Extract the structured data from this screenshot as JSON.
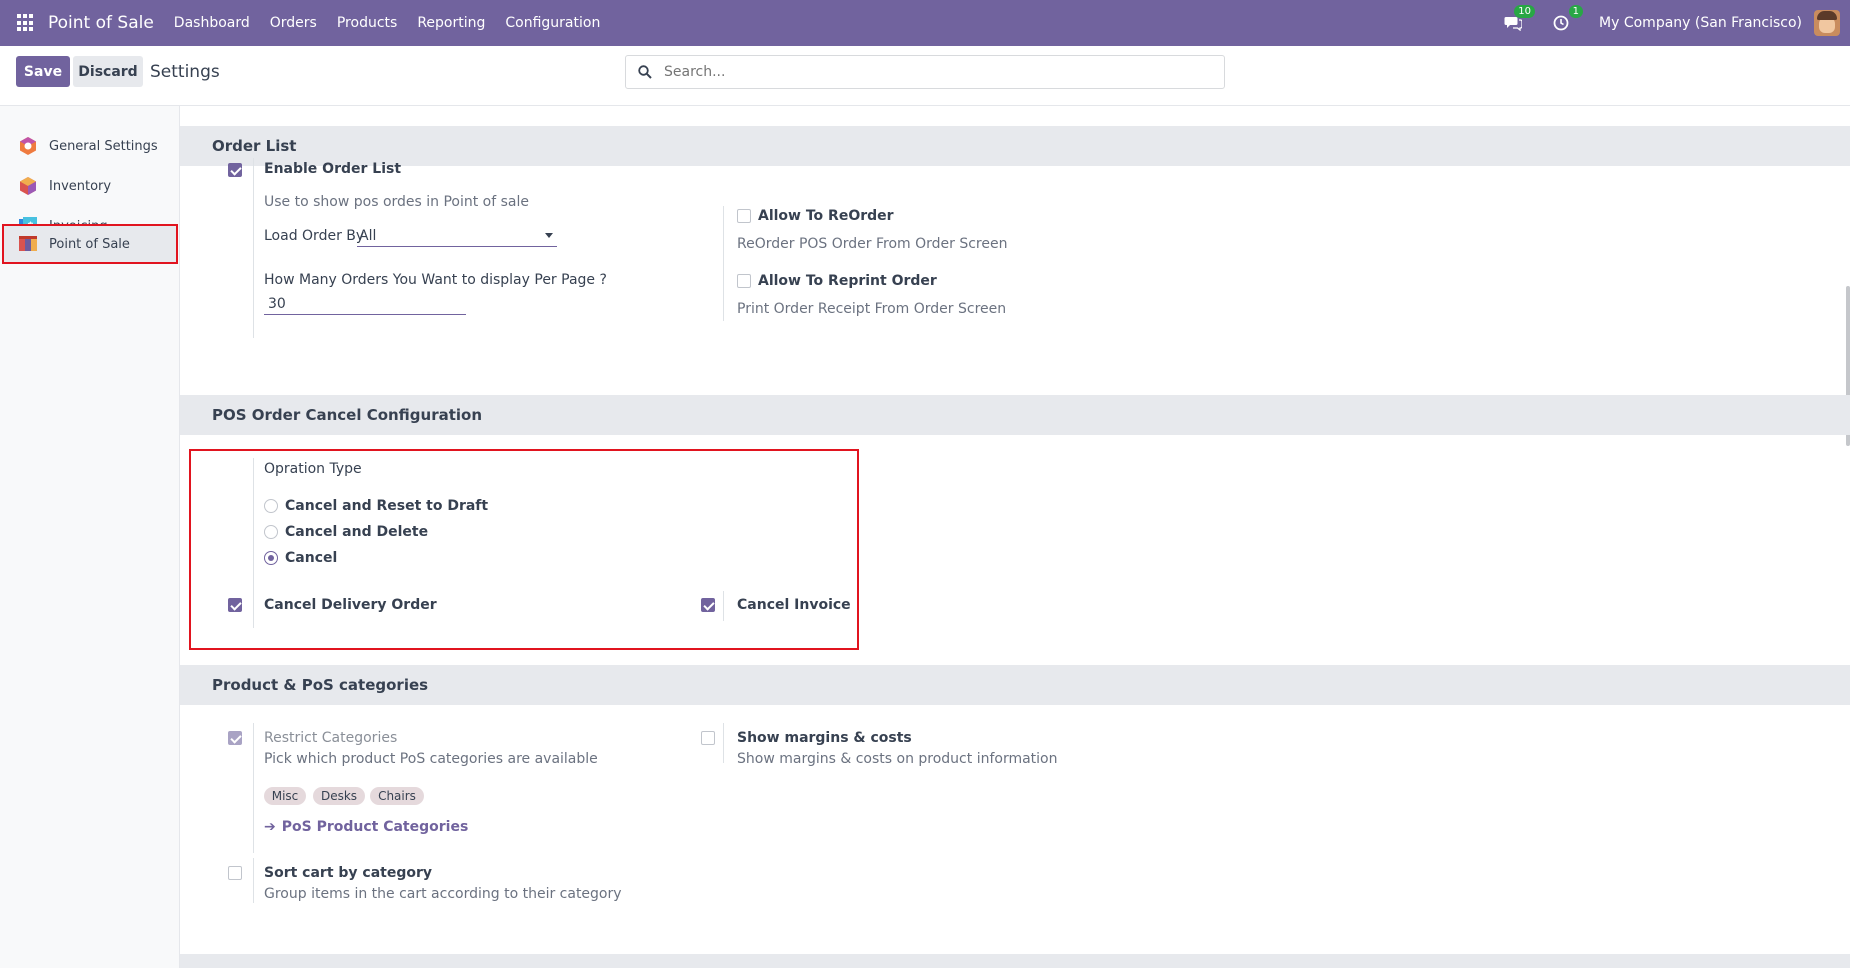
{
  "navbar": {
    "brand": "Point of Sale",
    "menu": [
      "Dashboard",
      "Orders",
      "Products",
      "Reporting",
      "Configuration"
    ],
    "messages_count": "10",
    "activities_count": "1",
    "company": "My Company (San Francisco)",
    "icons": {
      "apps": "apps-grid-icon",
      "messages": "chat-icon",
      "activities": "clock-icon"
    }
  },
  "control_panel": {
    "save_label": "Save",
    "discard_label": "Discard",
    "title": "Settings",
    "search_placeholder": "Search..."
  },
  "sidebar": {
    "items": [
      {
        "label": "General Settings",
        "icon": "general-settings-icon"
      },
      {
        "label": "Inventory",
        "icon": "inventory-icon"
      },
      {
        "label": "Invoicing",
        "icon": "invoicing-icon"
      },
      {
        "label": "Point of Sale",
        "icon": "point-of-sale-icon",
        "active": true
      }
    ]
  },
  "order_list": {
    "header": "Order List",
    "enable_label": "Enable Order List",
    "enable_checked": true,
    "enable_desc": "Use to show pos ordes in Point of sale",
    "load_order_label": "Load Order By",
    "load_order_value": "All",
    "per_page_label": "How Many Orders You Want to display Per Page ?",
    "per_page_value": "30",
    "reorder_label": "Allow To ReOrder",
    "reorder_checked": false,
    "reorder_desc": "ReOrder POS Order From Order Screen",
    "reprint_label": "Allow To Reprint Order",
    "reprint_checked": false,
    "reprint_desc": "Print Order Receipt From Order Screen"
  },
  "cancel_config": {
    "header": "POS Order Cancel Configuration",
    "operation_type_label": "Opration Type",
    "options": [
      {
        "label": "Cancel and Reset to Draft",
        "selected": false
      },
      {
        "label": "Cancel and Delete",
        "selected": false
      },
      {
        "label": "Cancel",
        "selected": true
      }
    ],
    "cancel_delivery_label": "Cancel Delivery Order",
    "cancel_delivery_checked": true,
    "cancel_invoice_label": "Cancel Invoice",
    "cancel_invoice_checked": true
  },
  "categories": {
    "header": "Product & PoS categories",
    "restrict_label": "Restrict Categories",
    "restrict_checked": true,
    "restrict_desc": "Pick which product PoS categories are available",
    "tags": [
      "Misc",
      "Desks",
      "Chairs"
    ],
    "link_label": "PoS Product Categories",
    "margins_label": "Show margins & costs",
    "margins_checked": false,
    "margins_desc": "Show margins & costs on product information",
    "sort_label": "Sort cart by category",
    "sort_checked": false,
    "sort_desc": "Group items in the cart according to their category"
  },
  "colors": {
    "brand": "#71639e",
    "highlight": "#e1141f",
    "badge": "#28a745"
  }
}
